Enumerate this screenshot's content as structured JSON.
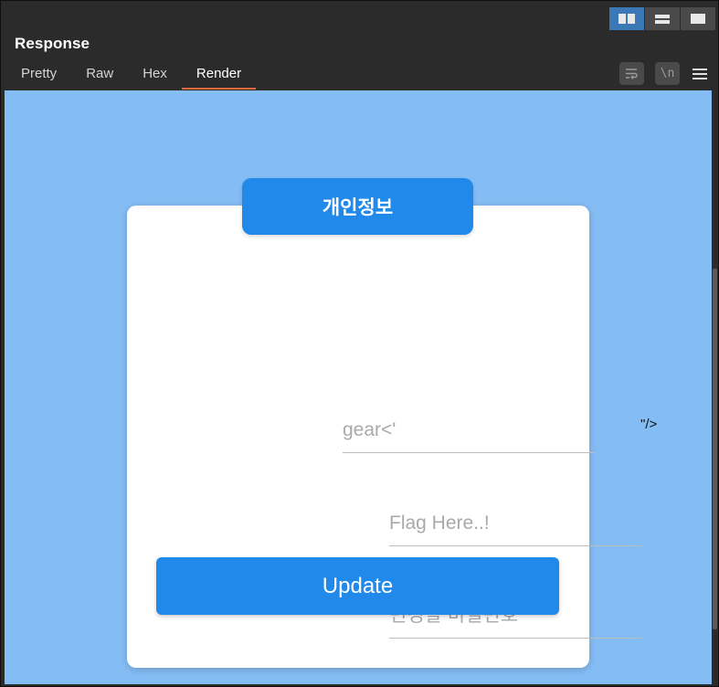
{
  "panel": {
    "title": "Response",
    "tabs": [
      {
        "label": "Pretty"
      },
      {
        "label": "Raw"
      },
      {
        "label": "Hex"
      },
      {
        "label": "Render"
      }
    ],
    "active_tab": "Render",
    "toolbar": {
      "newline_label": "\\n"
    }
  },
  "form": {
    "header": "개인정보",
    "field1_value": "gear<'",
    "stray_text": "\"/>",
    "field2_placeholder": "Flag Here..!",
    "field3_placeholder": "변경할 비밀번호",
    "submit_label": "Update"
  },
  "colors": {
    "accent": "#2089ea",
    "background": "#84bcf4",
    "active_tab_underline": "#e0683c"
  }
}
